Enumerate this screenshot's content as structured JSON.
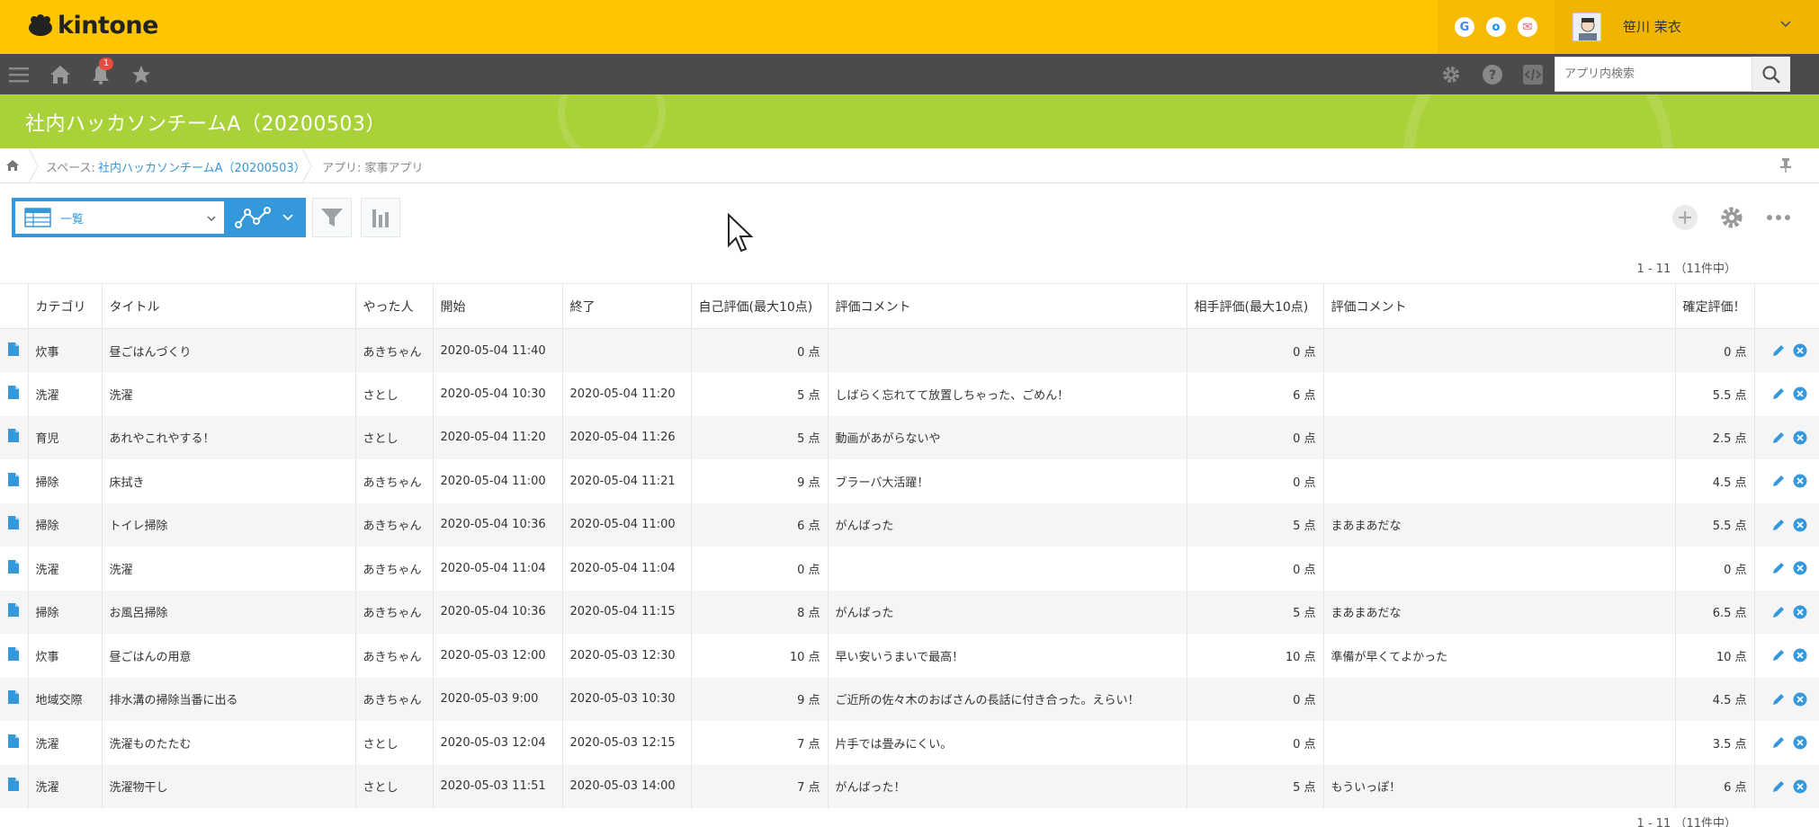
{
  "app": {
    "logo_text": "kintone",
    "brand_color": "#fec600",
    "accent_color": "#3498db"
  },
  "services": [
    "G",
    "o",
    "✉"
  ],
  "user": {
    "name": "笹川 茉衣"
  },
  "nav": {
    "notification_count": "1",
    "search_placeholder": "アプリ内検索"
  },
  "space": {
    "title": "社内ハッカソンチームA（20200503）"
  },
  "breadcrumb": {
    "space_prefix": "スペース: ",
    "space_name": "社内ハッカソンチームA（20200503）",
    "app": "アプリ: 家事アプリ"
  },
  "view": {
    "name": "一覧"
  },
  "paging": {
    "top": "1 - 11 （11件中）",
    "bottom": "1 - 11 （11件中）"
  },
  "table": {
    "headers": [
      "カテゴリ",
      "タイトル",
      "やった人",
      "開始",
      "終了",
      "自己評価(最大10点)",
      "評価コメント",
      "相手評価(最大10点)",
      "評価コメント",
      "確定評価！"
    ],
    "rows": [
      [
        "炊事",
        "昼ごはんづくり",
        "あきちゃん",
        "2020-05-04 11:40",
        "",
        "0 点",
        "",
        "0 点",
        "",
        "0 点"
      ],
      [
        "洗濯",
        "洗濯",
        "さとし",
        "2020-05-04 10:30",
        "2020-05-04 11:20",
        "5 点",
        "しばらく忘れてて放置しちゃった、ごめん！",
        "6 点",
        "",
        "5.5 点"
      ],
      [
        "育児",
        "あれやこれやする！",
        "さとし",
        "2020-05-04 11:20",
        "2020-05-04 11:26",
        "5 点",
        "動画があがらないや",
        "0 点",
        "",
        "2.5 点"
      ],
      [
        "掃除",
        "床拭き",
        "あきちゃん",
        "2020-05-04 11:00",
        "2020-05-04 11:21",
        "9 点",
        "ブラーバ大活躍！",
        "0 点",
        "",
        "4.5 点"
      ],
      [
        "掃除",
        "トイレ掃除",
        "あきちゃん",
        "2020-05-04 10:36",
        "2020-05-04 11:00",
        "6 点",
        "がんばった",
        "5 点",
        "まあまあだな",
        "5.5 点"
      ],
      [
        "洗濯",
        "洗濯",
        "あきちゃん",
        "2020-05-04 11:04",
        "2020-05-04 11:04",
        "0 点",
        "",
        "0 点",
        "",
        "0 点"
      ],
      [
        "掃除",
        "お風呂掃除",
        "あきちゃん",
        "2020-05-04 10:36",
        "2020-05-04 11:15",
        "8 点",
        "がんばった",
        "5 点",
        "まあまあだな",
        "6.5 点"
      ],
      [
        "炊事",
        "昼ごはんの用意",
        "あきちゃん",
        "2020-05-03 12:00",
        "2020-05-03 12:30",
        "10 点",
        "早い安いうまいで最高！",
        "10 点",
        "準備が早くてよかった",
        "10 点"
      ],
      [
        "地域交際",
        "排水溝の掃除当番に出る",
        "あきちゃん",
        "2020-05-03 9:00",
        "2020-05-03 10:30",
        "9 点",
        "ご近所の佐々木のおばさんの長話に付き合った。えらい！",
        "0 点",
        "",
        "4.5 点"
      ],
      [
        "洗濯",
        "洗濯ものたたむ",
        "さとし",
        "2020-05-03 12:04",
        "2020-05-03 12:15",
        "7 点",
        "片手では畳みにくい。",
        "0 点",
        "",
        "3.5 点"
      ],
      [
        "洗濯",
        "洗濯物干し",
        "さとし",
        "2020-05-03 11:51",
        "2020-05-03 14:00",
        "7 点",
        "がんばった！",
        "5 点",
        "もういっぽ！",
        "6 点"
      ]
    ]
  }
}
